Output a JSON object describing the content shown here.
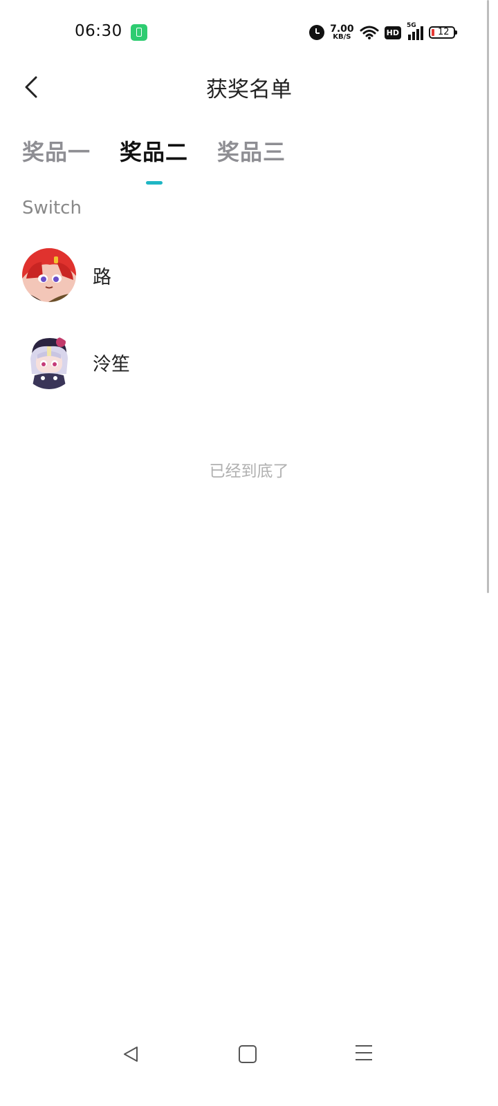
{
  "status_bar": {
    "time": "06:30",
    "speed_value": "7.00",
    "speed_unit": "KB/S",
    "hd": "HD",
    "network": "5G",
    "battery_level": "12",
    "battery_color": "#e53935"
  },
  "header": {
    "title": "获奖名单",
    "back_icon": "chevron-left-icon"
  },
  "tabs": [
    {
      "label": "奖品一",
      "active": false
    },
    {
      "label": "奖品二",
      "active": true
    },
    {
      "label": "奖品三",
      "active": false
    }
  ],
  "prize_name": "Switch",
  "winners": [
    {
      "name": "路",
      "avatar": "red-hair-anime-avatar"
    },
    {
      "name": "泠笙",
      "avatar": "white-hair-anime-avatar"
    }
  ],
  "end_text": "已经到底了",
  "colors": {
    "accent": "#1fb6c4",
    "muted_text": "#8e8e93"
  },
  "nav_bar": {
    "back": "back-triangle-icon",
    "home": "home-square-icon",
    "menu": "menu-lines-icon"
  }
}
